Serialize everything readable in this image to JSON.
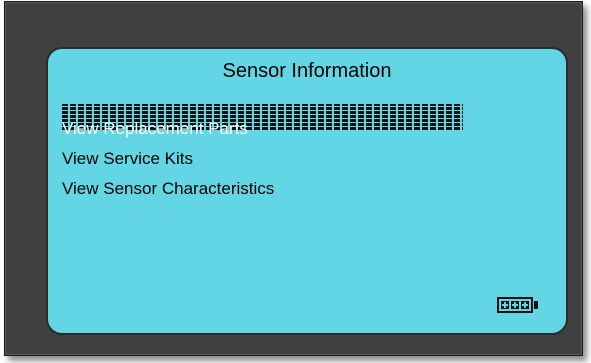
{
  "screen": {
    "title": "Sensor Information",
    "menu_items": [
      {
        "label": "View Replacement Parts",
        "selected": true
      },
      {
        "label": "View Service Kits",
        "selected": false
      },
      {
        "label": "View Sensor Characteristics",
        "selected": false
      }
    ]
  },
  "status": {
    "battery_icon": "battery-icon",
    "battery_level": 1.0
  },
  "colors": {
    "screen_bg": "#63d6e6",
    "device_body": "#404040",
    "selection_text": "#ffffff"
  }
}
